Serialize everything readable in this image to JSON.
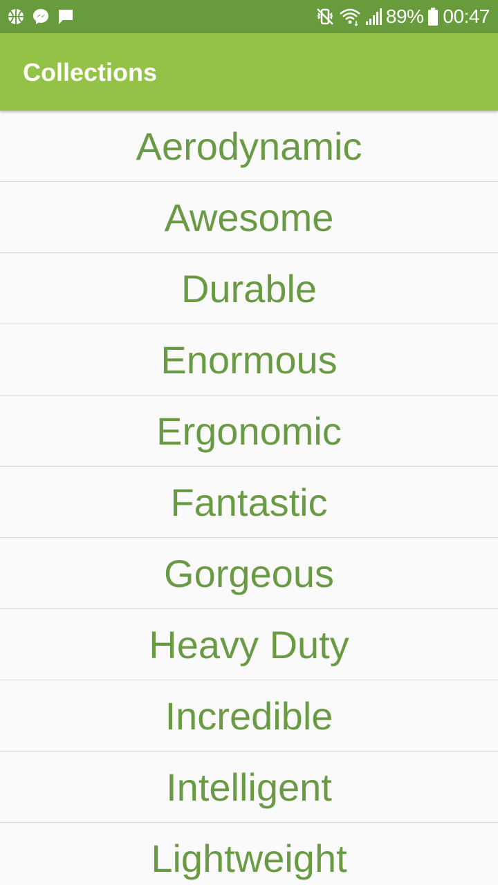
{
  "status_bar": {
    "battery": "89%",
    "time": "00:47",
    "left_icons": [
      "basketball-icon",
      "messenger-icon",
      "chat-icon"
    ],
    "right_icons": [
      "vibrate-mute-icon",
      "wifi-icon",
      "signal-icon",
      "battery-icon"
    ]
  },
  "app_bar": {
    "title": "Collections",
    "background": "#93c247"
  },
  "colors": {
    "status_bar": "#689b3b",
    "item_text": "#6a9b44",
    "divider": "#d5d5d5",
    "background": "#fafafa"
  },
  "collections": [
    "Aerodynamic",
    "Awesome",
    "Durable",
    "Enormous",
    "Ergonomic",
    "Fantastic",
    "Gorgeous",
    "Heavy Duty",
    "Incredible",
    "Intelligent",
    "Lightweight"
  ]
}
